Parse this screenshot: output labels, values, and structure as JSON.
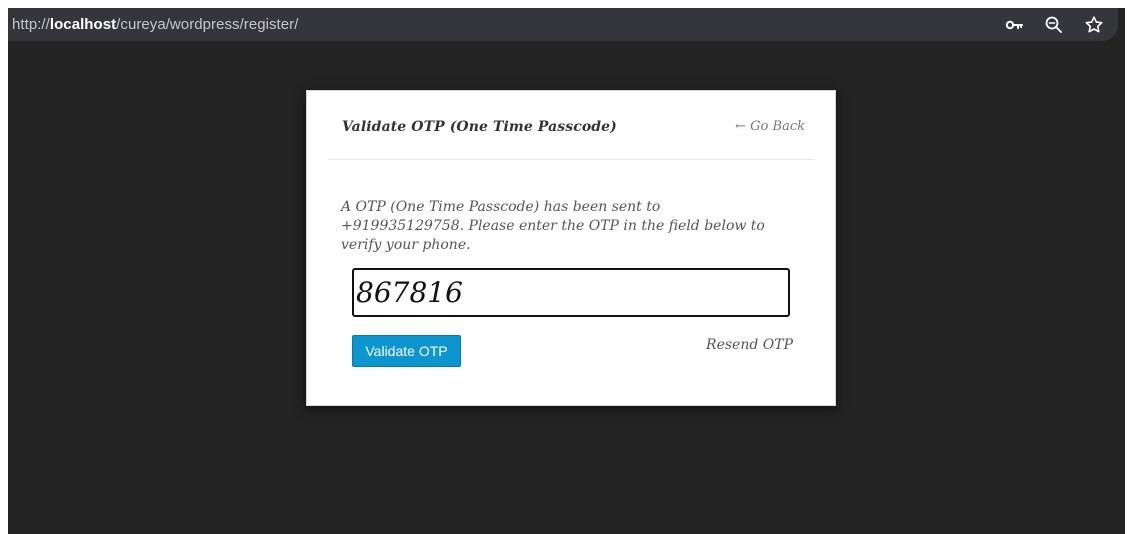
{
  "browser": {
    "url": {
      "prefix": "http://",
      "host": "localhost",
      "path": "/cureya/wordpress/register/"
    },
    "icons": [
      "key-icon",
      "zoom-icon",
      "star-icon"
    ]
  },
  "modal": {
    "title": "Validate OTP (One Time Passcode)",
    "go_back": "← Go Back",
    "message": "A OTP (One Time Passcode) has been sent to +919935129758. Please enter the OTP in the field below to verify your phone.",
    "otp_value": "867816",
    "validate_label": "Validate OTP",
    "resend_label": "Resend OTP"
  },
  "colors": {
    "page_background": "#232323",
    "address_bar": "#35363a",
    "button": "#0d95d0"
  }
}
